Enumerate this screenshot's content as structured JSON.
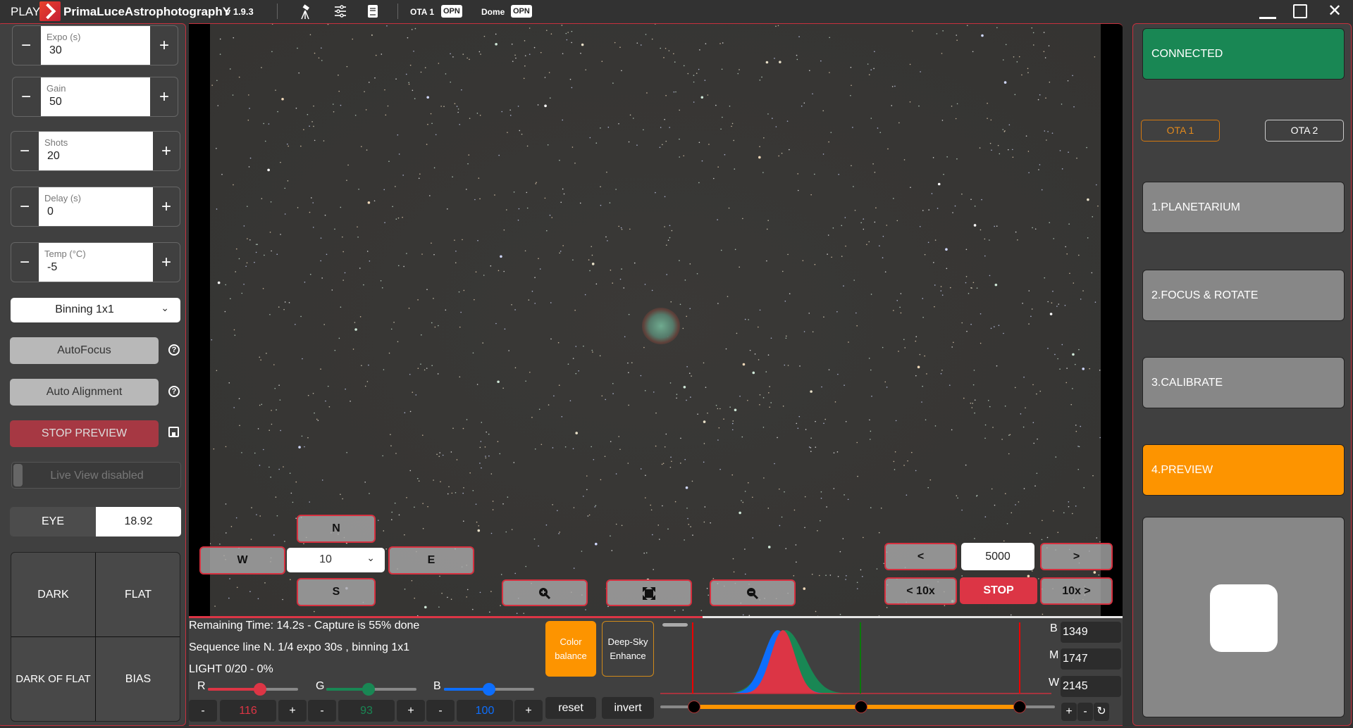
{
  "titlebar": {
    "play": "PLAY",
    "app_name": "PrimaLuceAstrophotographY",
    "version": "v 1.9.3",
    "icons": [
      "telescope-icon",
      "sliders-icon",
      "book-icon"
    ],
    "ota_label": "OTA 1",
    "ota_status": "OPN",
    "dome_label": "Dome",
    "dome_status": "OPN"
  },
  "left": {
    "steppers": [
      {
        "label": "Expo (s)",
        "value": "30"
      },
      {
        "label": "Gain",
        "value": "50"
      },
      {
        "label": "Shots",
        "value": "20"
      },
      {
        "label": "Delay (s)",
        "value": "0"
      },
      {
        "label": "Temp (°C)",
        "value": "-5"
      }
    ],
    "minus": "−",
    "plus": "+",
    "binning": "Binning 1x1",
    "autofocus": "AutoFocus",
    "auto_alignment": "Auto Alignment",
    "stop_preview": "STOP PREVIEW",
    "live_view": "Live View disabled",
    "eye_label": "EYE",
    "eye_value": "18.92",
    "calib": [
      "DARK",
      "FLAT",
      "DARK OF FLAT",
      "BIAS"
    ],
    "help": "?"
  },
  "image": {
    "nav": {
      "n": "N",
      "s": "S",
      "w": "W",
      "e": "E",
      "step": "10"
    },
    "focuser": {
      "prev": "<",
      "next": ">",
      "value": "5000",
      "prev10": "< 10x",
      "next10": "10x >",
      "stop": "STOP"
    },
    "progress_percent": 55
  },
  "status": {
    "remaining": "Remaining Time: 14.2s  -  Capture is 55% done",
    "sequence": "Sequence line N. 1/4 expo 30s , binning 1x1",
    "light": "LIGHT 0/20 - 0%"
  },
  "color": {
    "r_label": "R",
    "g_label": "G",
    "b_label": "B",
    "r": "116",
    "g": "93",
    "b": "100",
    "r_level": 0.58,
    "g_level": 0.47,
    "b_level": 0.5,
    "minus": "-",
    "plus": "+",
    "color_balance": "Color balance",
    "deep_sky": "Deep-Sky Enhance",
    "reset": "reset",
    "invert": "invert",
    "colors": {
      "r": "#dc3545",
      "g": "#198754",
      "b": "#0d6efd",
      "orange": "#fd9400"
    }
  },
  "histogram": {
    "b_label": "B",
    "m_label": "M",
    "w_label": "W",
    "b": "1349",
    "m": "1747",
    "w": "2145",
    "plus": "+",
    "minus": "-"
  },
  "right": {
    "connected": "CONNECTED",
    "ota1": "OTA 1",
    "ota2": "OTA 2",
    "steps": [
      "1.PLANETARIUM",
      "2.FOCUS & ROTATE",
      "3.CALIBRATE",
      "4.PREVIEW"
    ]
  }
}
